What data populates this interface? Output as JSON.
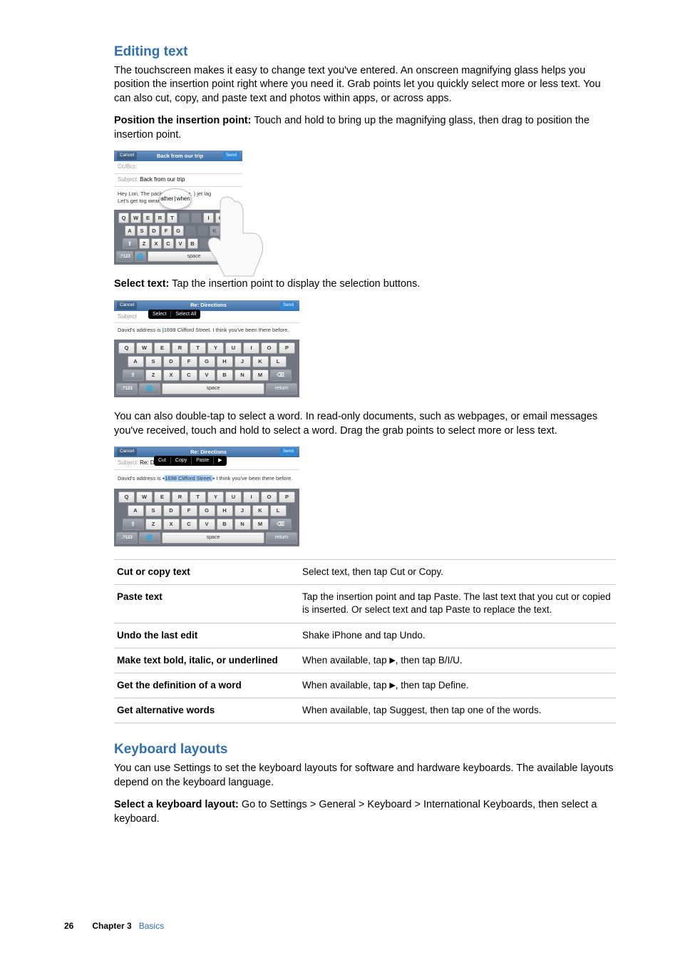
{
  "section1": {
    "heading": "Editing text",
    "para1": "The touchscreen makes it easy to change text you've entered. An onscreen magnifying glass helps you position the insertion point right where you need it. Grab points let you quickly select more or less text. You can also cut, copy, and paste text and photos within apps, or across apps.",
    "lead2": "Position the insertion point:",
    "para2": "  Touch and hold to bring up the magnifying glass, then drag to position the insertion point.",
    "lead3": "Select text:",
    "para3": "  Tap the insertion point to display the selection buttons.",
    "para4": "You can also double-tap to select a word. In read-only documents, such as webpages, or email messages you've received, touch and hold to select a word. Drag the grab points to select more or less text."
  },
  "fig1": {
    "cancel": "Cancel",
    "send": "Send",
    "title": "Back from our trip",
    "ccbcc": "Cc/Bcc:",
    "subj_label": "Subject: ",
    "subj_val": "Back from our trip",
    "body_pre": "Hey Lori,\nThe pack ar",
    "body_post": "m Belize.\n) jet lag",
    "body_tail": "Let's get tog\nwears off.",
    "loupe_pre": "ather",
    "loupe_post": "when",
    "space": "space"
  },
  "fig2": {
    "cancel": "Cancel",
    "send": "Send",
    "title": "Re: Directions",
    "subj_label": "Subject",
    "body_pre": "David's address is ",
    "body_cursor": "1",
    "body_post": "698 Clifford Street. I think you've been there before.",
    "menu1": "Select",
    "menu2": "Select All",
    "space": "space",
    "return": "return"
  },
  "fig3": {
    "cancel": "Cancel",
    "send": "Send",
    "title": "Re: Directions",
    "subj_label": "Subject: ",
    "subj_val": "Re: D",
    "body_pre": "David's address is ",
    "body_sel": "1698 Clifford Street.",
    "body_post": " I think you've been there before.",
    "menu1": "Cut",
    "menu2": "Copy",
    "menu3": "Paste",
    "menu4": "▶",
    "space": "space",
    "return": "return"
  },
  "kb": {
    "row1": [
      "Q",
      "W",
      "E",
      "R",
      "T",
      "Y",
      "U",
      "I",
      "O",
      "P"
    ],
    "row2": [
      "A",
      "S",
      "D",
      "F",
      "G",
      "H",
      "J",
      "K",
      "L"
    ],
    "row3": [
      "Z",
      "X",
      "C",
      "V",
      "B",
      "N",
      "M"
    ],
    "shift": "⇧",
    "bksp": "⌫",
    "mode": ".?123",
    "globe": "🌐"
  },
  "table": {
    "r1a": "Cut or copy text",
    "r1b": "Select text, then tap Cut or Copy.",
    "r2a": "Paste text",
    "r2b": "Tap the insertion point and tap Paste. The last text that you cut or copied is inserted. Or select text and tap Paste to replace the text.",
    "r3a": "Undo the last edit",
    "r3b": "Shake iPhone and tap Undo.",
    "r4a": "Make text bold, italic, or underlined",
    "r4b_pre": "When available, tap ",
    "r4b_post": ", then tap B/I/U.",
    "r5a": "Get the definition of a word",
    "r5b_pre": "When available, tap ",
    "r5b_post": ", then tap Define.",
    "r6a": "Get alternative words",
    "r6b": "When available, tap Suggest, then tap one of the words."
  },
  "section2": {
    "heading": "Keyboard layouts",
    "para1": "You can use Settings to set the keyboard layouts for software and hardware keyboards. The available layouts depend on the keyboard language.",
    "lead2": "Select a keyboard layout:",
    "para2": "  Go to Settings > General > Keyboard > International Keyboards, then select a keyboard."
  },
  "footer": {
    "page": "26",
    "chapter": "Chapter 3",
    "section": "Basics"
  }
}
